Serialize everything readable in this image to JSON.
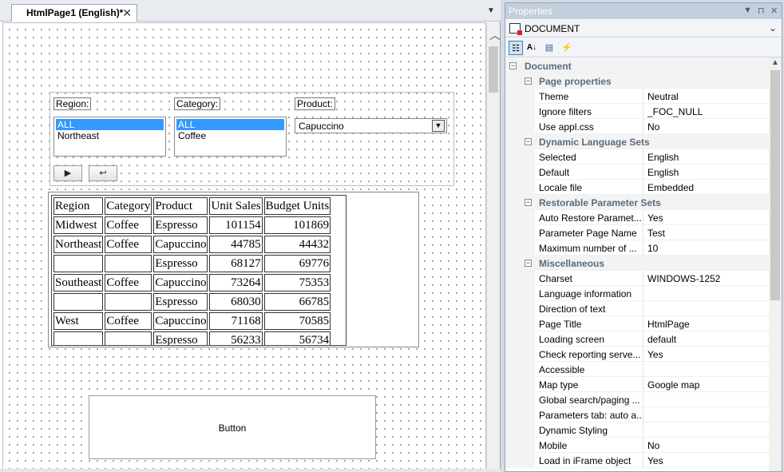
{
  "designer": {
    "tab_label": "HtmlPage1 (English)*",
    "tab_close": "✕",
    "tab_menu": "▼"
  },
  "form": {
    "region_label": "Region:",
    "region_options": [
      "ALL",
      "Northeast"
    ],
    "category_label": "Category:",
    "category_options": [
      "ALL",
      "Coffee"
    ],
    "product_label": "Product:",
    "product_value": "Capuccino",
    "run_button": "▶",
    "reset_button": "↩"
  },
  "report": {
    "headers": [
      "Region",
      "Category",
      "Product",
      "Unit Sales",
      "Budget Units"
    ],
    "rows": [
      [
        "Midwest",
        "Coffee",
        "Espresso",
        "101154",
        "101869"
      ],
      [
        "Northeast",
        "Coffee",
        "Capuccino",
        "44785",
        "44432"
      ],
      [
        "",
        "",
        "Espresso",
        "68127",
        "69776"
      ],
      [
        "Southeast",
        "Coffee",
        "Capuccino",
        "73264",
        "75353"
      ],
      [
        "",
        "",
        "Espresso",
        "68030",
        "66785"
      ],
      [
        "West",
        "Coffee",
        "Capuccino",
        "71168",
        "70585"
      ],
      [
        "",
        "",
        "Espresso",
        "56233",
        "56734"
      ]
    ]
  },
  "canvas_button_label": "Button",
  "properties": {
    "title": "Properties",
    "object": "DOCUMENT",
    "rows": [
      {
        "type": "cat",
        "name": "Document",
        "top": true
      },
      {
        "type": "cat",
        "name": "Page properties"
      },
      {
        "type": "prop",
        "name": "Theme",
        "value": "Neutral"
      },
      {
        "type": "prop",
        "name": "Ignore filters",
        "value": "_FOC_NULL"
      },
      {
        "type": "prop",
        "name": "Use appl.css",
        "value": "No"
      },
      {
        "type": "cat",
        "name": "Dynamic Language Sets"
      },
      {
        "type": "prop",
        "name": "Selected",
        "value": "English"
      },
      {
        "type": "prop",
        "name": "Default",
        "value": "English"
      },
      {
        "type": "prop",
        "name": "Locale file",
        "value": "Embedded"
      },
      {
        "type": "cat",
        "name": "Restorable Parameter Sets"
      },
      {
        "type": "prop",
        "name": "Auto Restore Paramet...",
        "value": "Yes"
      },
      {
        "type": "prop",
        "name": "Parameter Page Name",
        "value": "Test"
      },
      {
        "type": "prop",
        "name": "Maximum number of ...",
        "value": "10"
      },
      {
        "type": "cat",
        "name": "Miscellaneous"
      },
      {
        "type": "prop",
        "name": "Charset",
        "value": "WINDOWS-1252"
      },
      {
        "type": "prop",
        "name": "Language information",
        "value": ""
      },
      {
        "type": "prop",
        "name": "Direction of text",
        "value": ""
      },
      {
        "type": "prop",
        "name": "Page Title",
        "value": "HtmlPage"
      },
      {
        "type": "prop",
        "name": "Loading screen",
        "value": "default"
      },
      {
        "type": "prop",
        "name": "Check reporting serve...",
        "value": "Yes"
      },
      {
        "type": "prop",
        "name": "Accessible",
        "value": ""
      },
      {
        "type": "prop",
        "name": "Map type",
        "value": "Google map"
      },
      {
        "type": "prop",
        "name": "Global search/paging ...",
        "value": ""
      },
      {
        "type": "prop",
        "name": "Parameters tab: auto a...",
        "value": ""
      },
      {
        "type": "prop",
        "name": "Dynamic Styling",
        "value": ""
      },
      {
        "type": "prop",
        "name": "Mobile",
        "value": "No"
      },
      {
        "type": "prop",
        "name": "Load in iFrame object",
        "value": "Yes"
      }
    ]
  }
}
